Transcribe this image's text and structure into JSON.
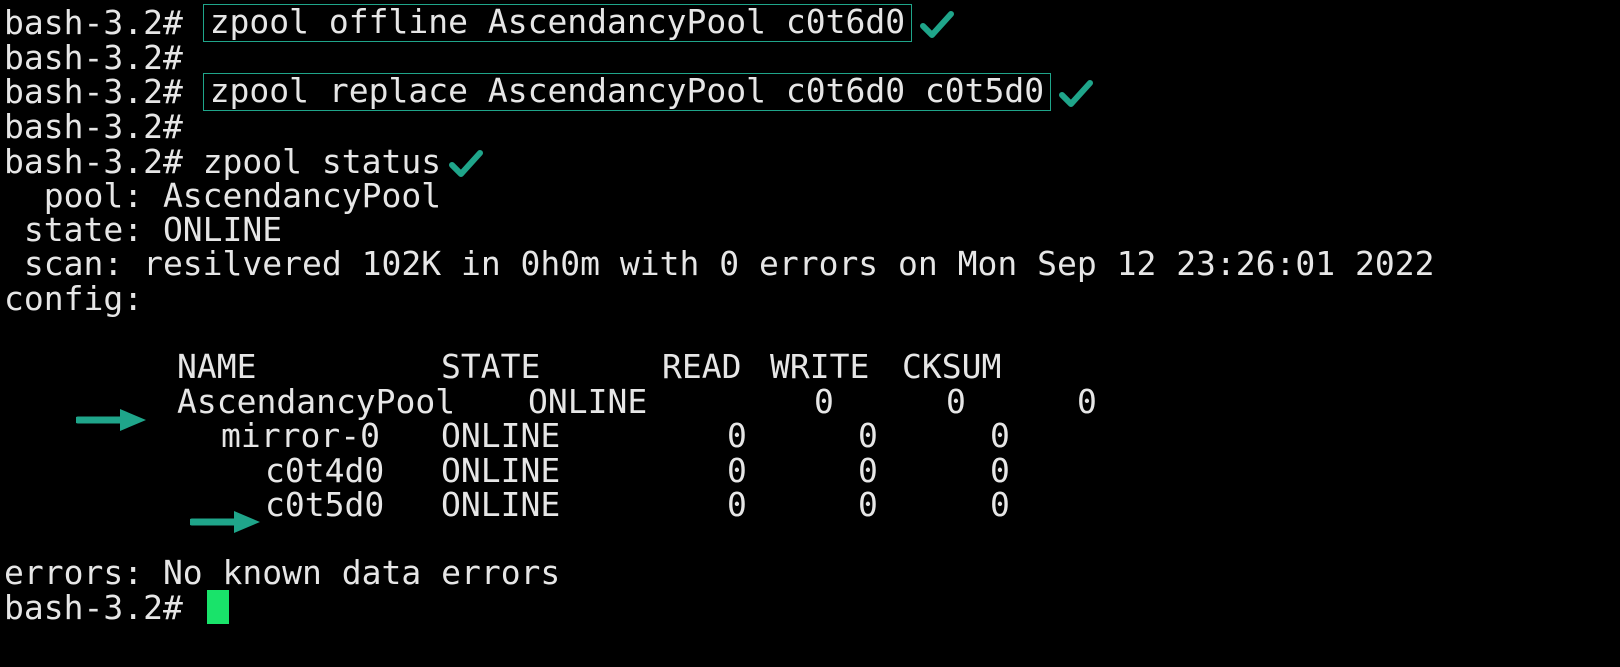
{
  "terminal": {
    "prompt": "bash-3.2#",
    "commands": {
      "offline": "zpool offline AscendancyPool c0t6d0",
      "replace": "zpool replace AscendancyPool c0t6d0 c0t5d0",
      "status": "zpool status"
    },
    "output": {
      "pool_line": "  pool: AscendancyPool",
      "state_line": " state: ONLINE",
      "scan_line": " scan: resilvered 102K in 0h0m with 0 errors on Mon Sep 12 23:26:01 2022",
      "config_line": "config:",
      "errors_line": "errors: No known data errors"
    },
    "config_table": {
      "headers": {
        "name": "NAME",
        "state": "STATE",
        "read": "READ",
        "write": "WRITE",
        "cksum": "CKSUM"
      },
      "rows": [
        {
          "name": "AscendancyPool",
          "state": "ONLINE",
          "read": "0",
          "write": "0",
          "cksum": "0"
        },
        {
          "name": "mirror-0",
          "state": "ONLINE",
          "read": "0",
          "write": "0",
          "cksum": "0"
        },
        {
          "name": "c0t4d0",
          "state": "ONLINE",
          "read": "0",
          "write": "0",
          "cksum": "0"
        },
        {
          "name": "c0t5d0",
          "state": "ONLINE",
          "read": "0",
          "write": "0",
          "cksum": "0"
        }
      ]
    },
    "colors": {
      "background": "#000000",
      "text": "#e6e6e6",
      "annotation": "#1fa58a",
      "cursor": "#19e36a"
    },
    "icons": {
      "check": "check-icon",
      "arrow": "arrow-right-icon"
    }
  }
}
